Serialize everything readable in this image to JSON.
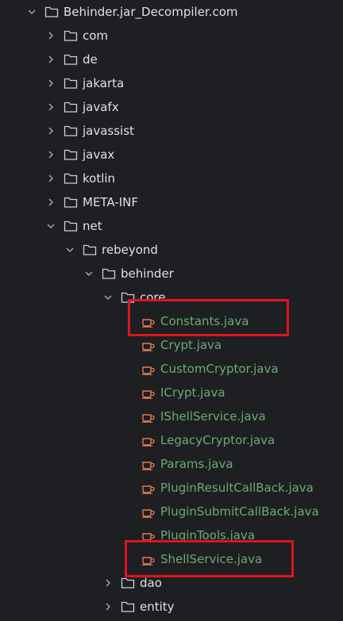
{
  "colors": {
    "background": "#1e1f22",
    "text": "#dfe1e5",
    "java_text": "#6aab73",
    "java_icon": "#e07b53",
    "highlight": "#e0141a"
  },
  "tree": {
    "root": "Behinder.jar_Decompiler.com",
    "folders_top": [
      "com",
      "de",
      "jakarta",
      "javafx",
      "javassist",
      "javax",
      "kotlin",
      "META-INF"
    ],
    "net": "net",
    "rebeyond": "rebeyond",
    "behinder": "behinder",
    "core": "core",
    "files": [
      "Constants.java",
      "Crypt.java",
      "CustomCryptor.java",
      "ICrypt.java",
      "IShellService.java",
      "LegacyCryptor.java",
      "Params.java",
      "PluginResultCallBack.java",
      "PluginSubmitCallBack.java",
      "PluginTools.java",
      "ShellService.java"
    ],
    "folders_bottom": [
      "dao",
      "entity"
    ]
  }
}
